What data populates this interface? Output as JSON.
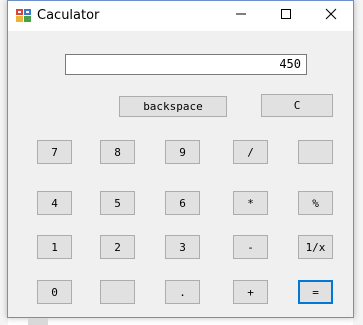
{
  "window": {
    "title": "Caculator"
  },
  "titlebar": {
    "icons": {
      "app": "calculator-app-icon",
      "minimize": "minimize-icon",
      "maximize": "maximize-icon",
      "close": "close-icon"
    }
  },
  "display": {
    "value": "450"
  },
  "buttons": {
    "backspace": "backspace",
    "clear": "C",
    "seven": "7",
    "eight": "8",
    "nine": "9",
    "divide": "/",
    "row1_blank": "",
    "four": "4",
    "five": "5",
    "six": "6",
    "multiply": "*",
    "percent": "%",
    "one": "1",
    "two": "2",
    "three": "3",
    "subtract": "-",
    "reciprocal": "1/x",
    "zero": "0",
    "row4_blank": "",
    "decimal": ".",
    "add": "+",
    "equals": "="
  },
  "colors": {
    "button_face": "#e1e1e1",
    "window_bg": "#f0f0f0",
    "focus_border": "#0078d7"
  }
}
